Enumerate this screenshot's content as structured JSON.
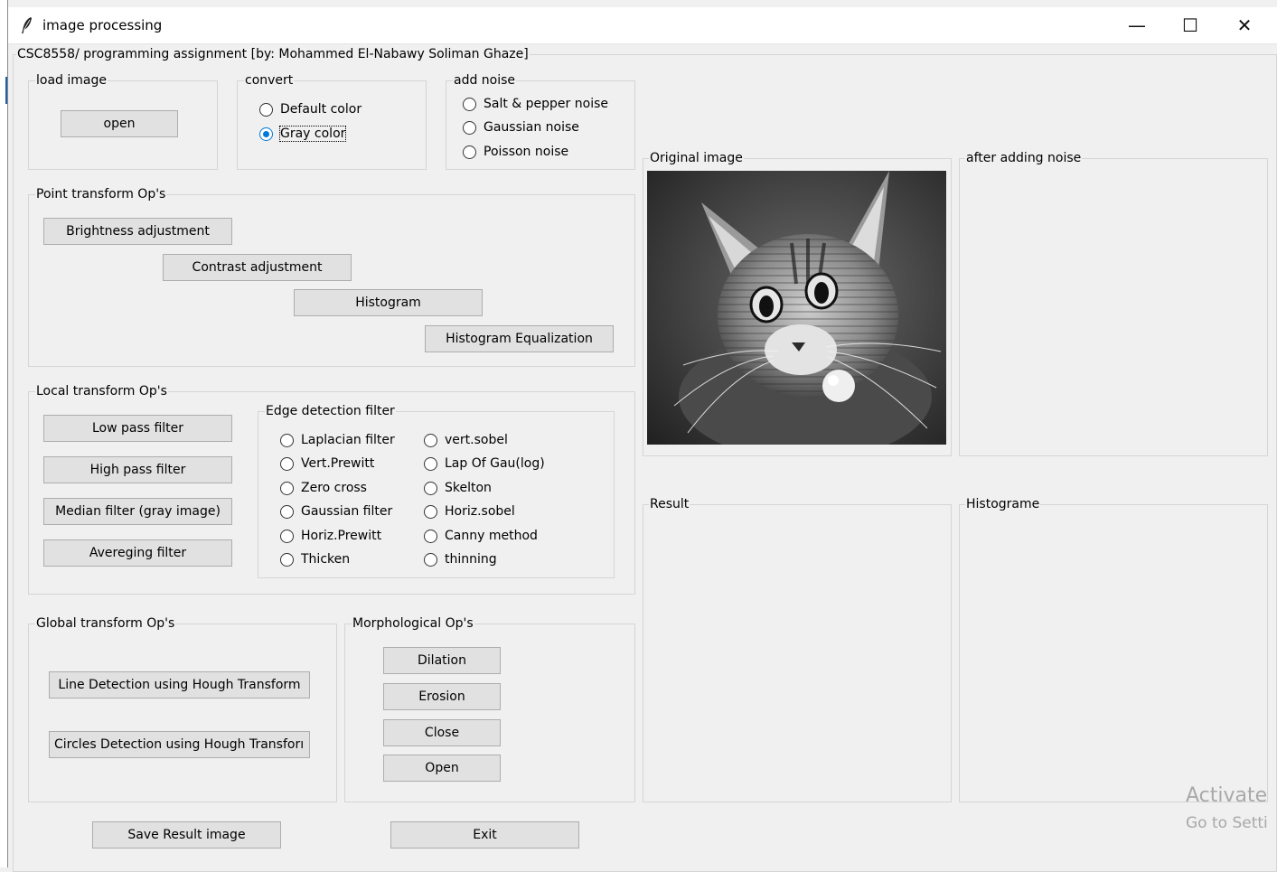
{
  "window": {
    "title": "image processing",
    "feather_icon": "feather-icon",
    "minimize_glyph": "—",
    "maximize_glyph": "☐",
    "close_glyph": "✕"
  },
  "app": {
    "header_label": "CSC8558/ programming assignment [by: Mohammed El-Nabawy Soliman Ghaze]"
  },
  "load_image": {
    "legend": "load image",
    "open_button": "open"
  },
  "convert": {
    "legend": "convert",
    "options": [
      "Default color",
      "Gray color"
    ],
    "selected": "Gray color"
  },
  "add_noise": {
    "legend": "add noise",
    "options": [
      "Salt & pepper noise",
      "Gaussian noise",
      "Poisson noise"
    ],
    "selected": null
  },
  "point_transform": {
    "legend": "Point transform Op's",
    "buttons": [
      "Brightness adjustment",
      "Contrast adjustment",
      "Histogram",
      "Histogram Equalization"
    ]
  },
  "local_transform": {
    "legend": "Local transform Op's",
    "buttons": [
      "Low pass filter",
      "High pass filter",
      "Median filter (gray image)",
      "Avereging filter"
    ],
    "edge_detection": {
      "legend": "Edge detection filter",
      "left_options": [
        "Laplacian filter",
        "Vert.Prewitt",
        "Zero cross",
        "Gaussian filter",
        "Horiz.Prewitt",
        "Thicken"
      ],
      "right_options": [
        "vert.sobel",
        "Lap Of Gau(log)",
        "Skelton",
        "Horiz.sobel",
        "Canny method",
        "thinning"
      ]
    }
  },
  "global_transform": {
    "legend": "Global transform Op's",
    "buttons": [
      "Line Detection using Hough Transform",
      "Circles Detection using Hough Transforı"
    ]
  },
  "morphological": {
    "legend": "Morphological Op's",
    "buttons": [
      "Dilation",
      "Erosion",
      "Close",
      "Open"
    ]
  },
  "footer": {
    "save_button": "Save Result image",
    "exit_button": "Exit"
  },
  "panels": {
    "original": "Original image",
    "after_noise": "after adding noise",
    "result": "Result",
    "histogram": "Histograme"
  },
  "watermark": {
    "line1": "Activate",
    "line2": "Go to Setti"
  }
}
